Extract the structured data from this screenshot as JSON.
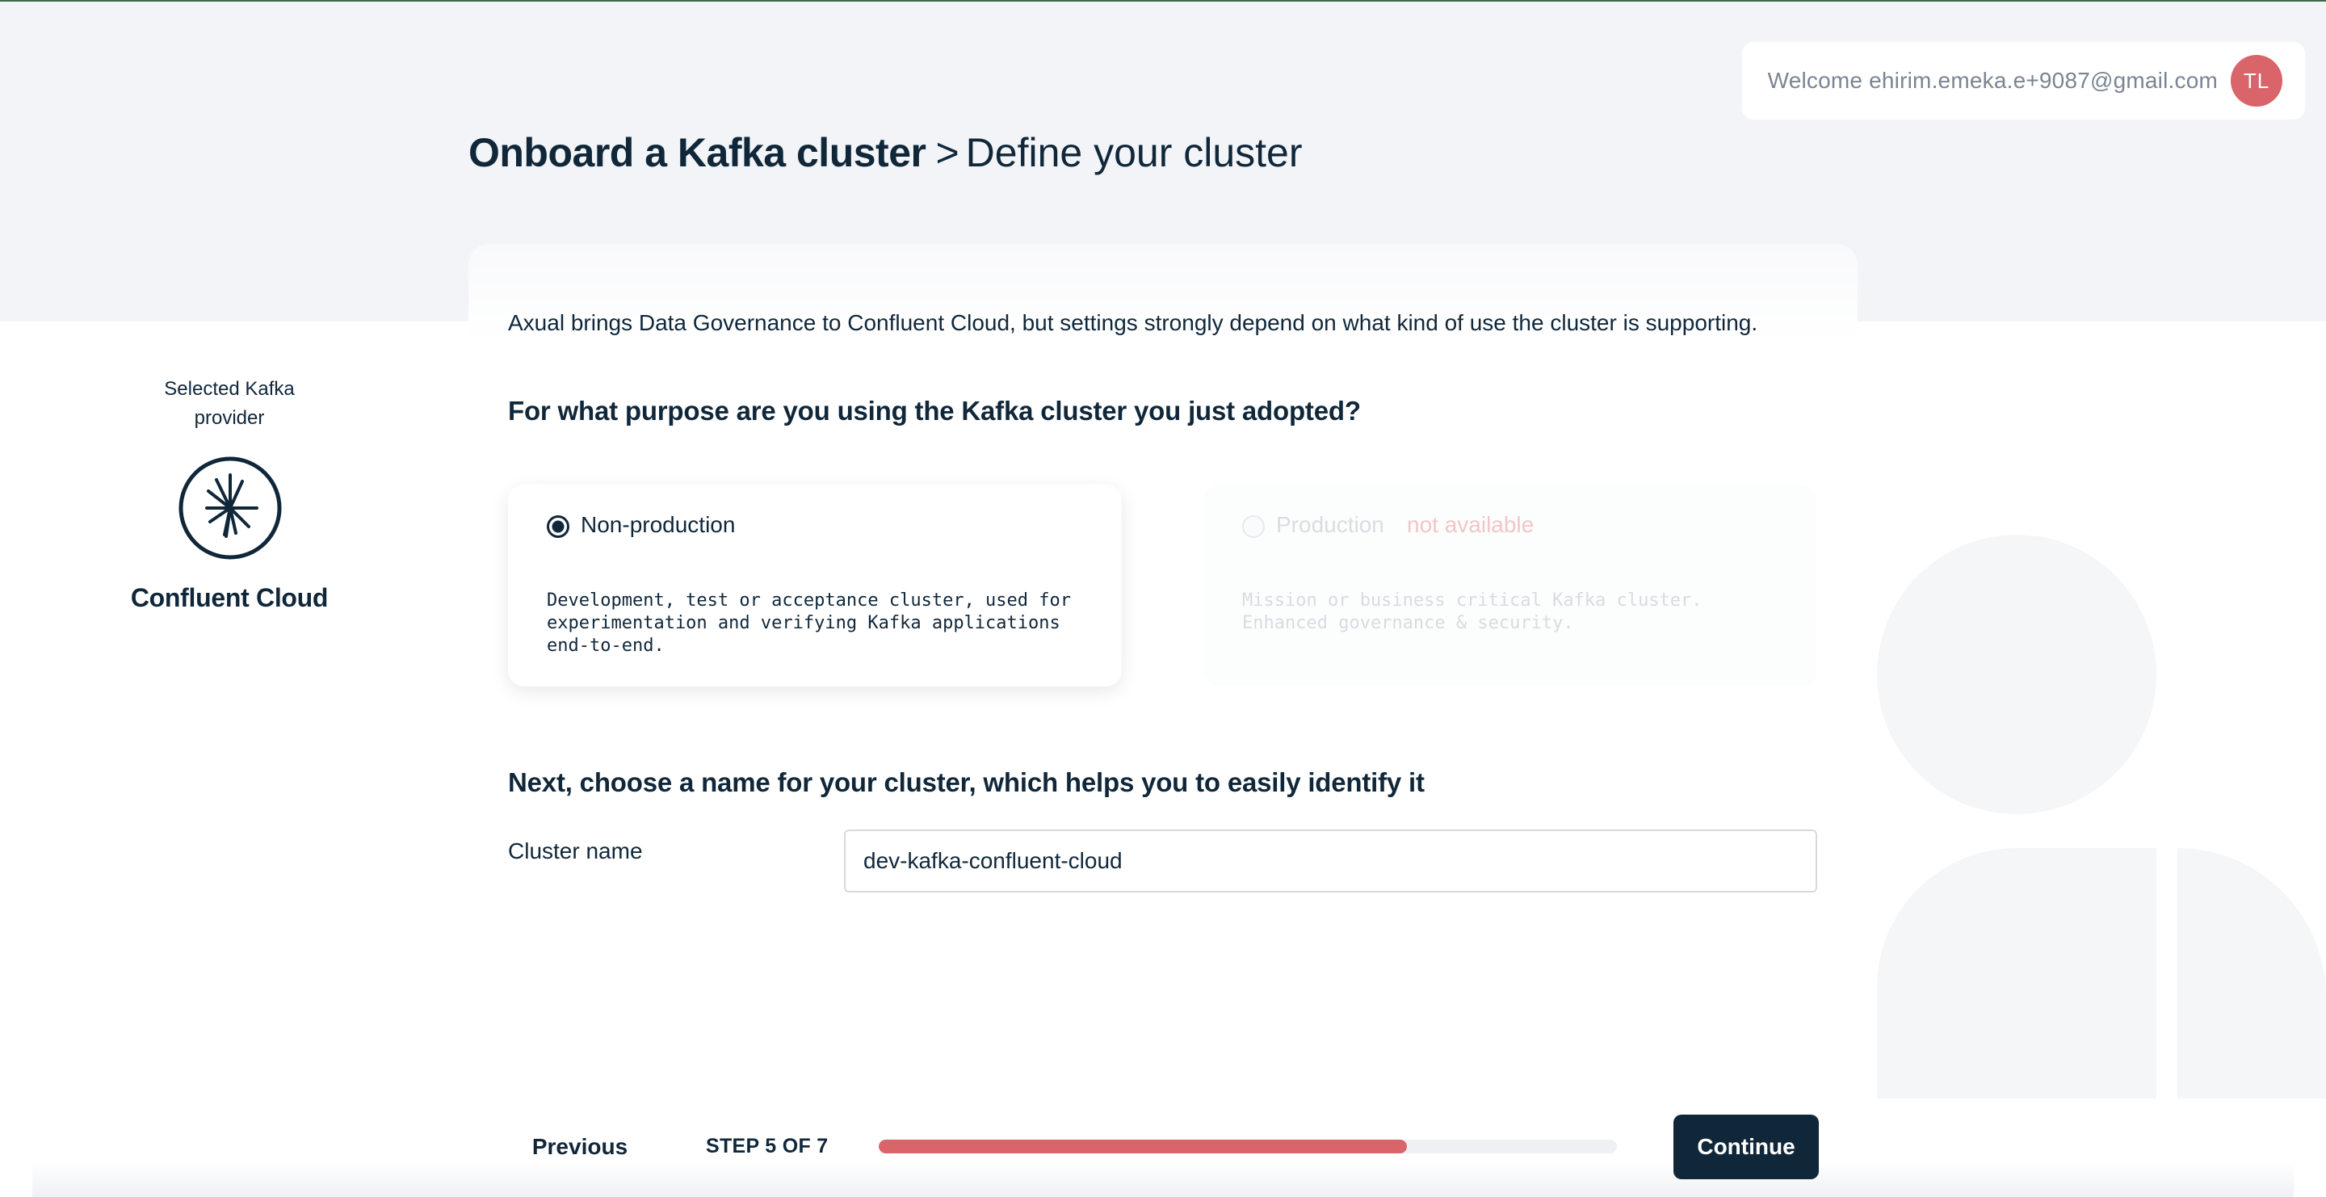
{
  "header": {
    "welcome_text": "Welcome ehirim.emeka.e+9087@gmail.com",
    "avatar_initials": "TL"
  },
  "title": {
    "main": "Onboard a Kafka cluster",
    "separator": ">",
    "step": "Define your cluster"
  },
  "sidebar": {
    "caption": "Selected Kafka provider",
    "provider_name": "Confluent Cloud",
    "provider_logo_icon": "confluent-logo-icon"
  },
  "content": {
    "intro": "Axual brings Data Governance to Confluent Cloud, but settings strongly depend on what kind of use the cluster is supporting.",
    "purpose_question": "For what purpose are you using the Kafka cluster you just adopted?",
    "options": [
      {
        "label": "Non-production",
        "description": "Development, test or acceptance cluster, used for experimentation and verifying Kafka applications end-to-end.",
        "selected": true,
        "available": true
      },
      {
        "label": "Production",
        "badge": "not available",
        "description": "Mission or business critical Kafka cluster. Enhanced governance & security.",
        "selected": false,
        "available": false
      }
    ],
    "name_question": "Next, choose a name for your cluster, which helps you to easily identify it",
    "cluster_name_label": "Cluster name",
    "cluster_name_value": "dev-kafka-confluent-cloud"
  },
  "footer": {
    "previous_label": "Previous",
    "step_text": "STEP 5 OF 7",
    "progress": 0.715,
    "continue_label": "Continue"
  },
  "colors": {
    "primary": "#10273a",
    "accent": "#d9646a",
    "background": "#f2f4f7"
  }
}
